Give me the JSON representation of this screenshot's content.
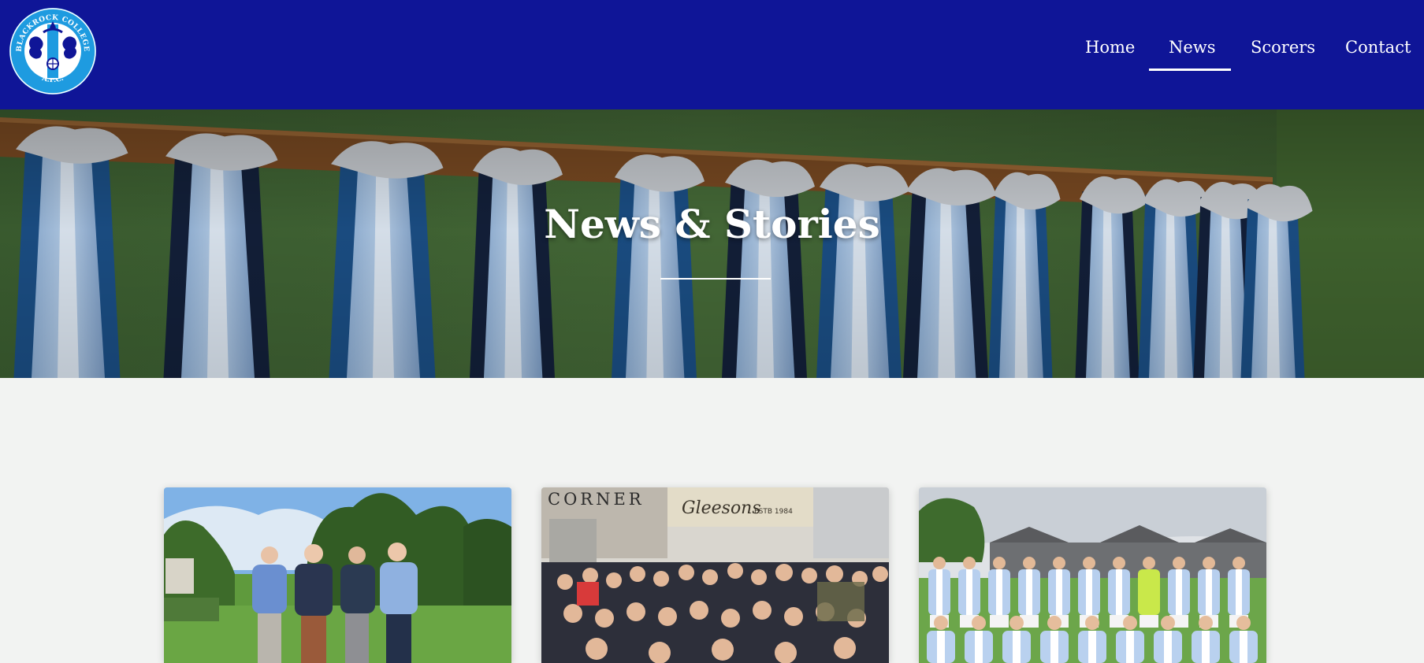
{
  "header": {
    "logo": {
      "text_top": "BLACKROCK COLLEGE",
      "text_bottom": "A.F.C.",
      "colors": {
        "ring": "#1e9be0",
        "inner": "#ffffff",
        "crest": "#0f1597"
      }
    },
    "nav": [
      {
        "label": "Home",
        "active": false
      },
      {
        "label": "News",
        "active": true
      },
      {
        "label": "Scorers",
        "active": false
      },
      {
        "label": "Contact",
        "active": false
      }
    ],
    "background_color": "#0f1597"
  },
  "hero": {
    "title": "News & Stories",
    "image": "football-jerseys-hanging-on-pegs",
    "wall_color": "#3f6232",
    "jersey_colors": [
      "#a9c6e6",
      "#142033"
    ]
  },
  "cards": [
    {
      "image": "four-men-on-golf-course"
    },
    {
      "image": "group-photo-outside-gleesons-corner",
      "signs": [
        "CORNER",
        "Gleesons",
        "ESTB 1984"
      ]
    },
    {
      "image": "football-team-photo-on-pitch"
    }
  ],
  "page_background": "#f2f3f2"
}
